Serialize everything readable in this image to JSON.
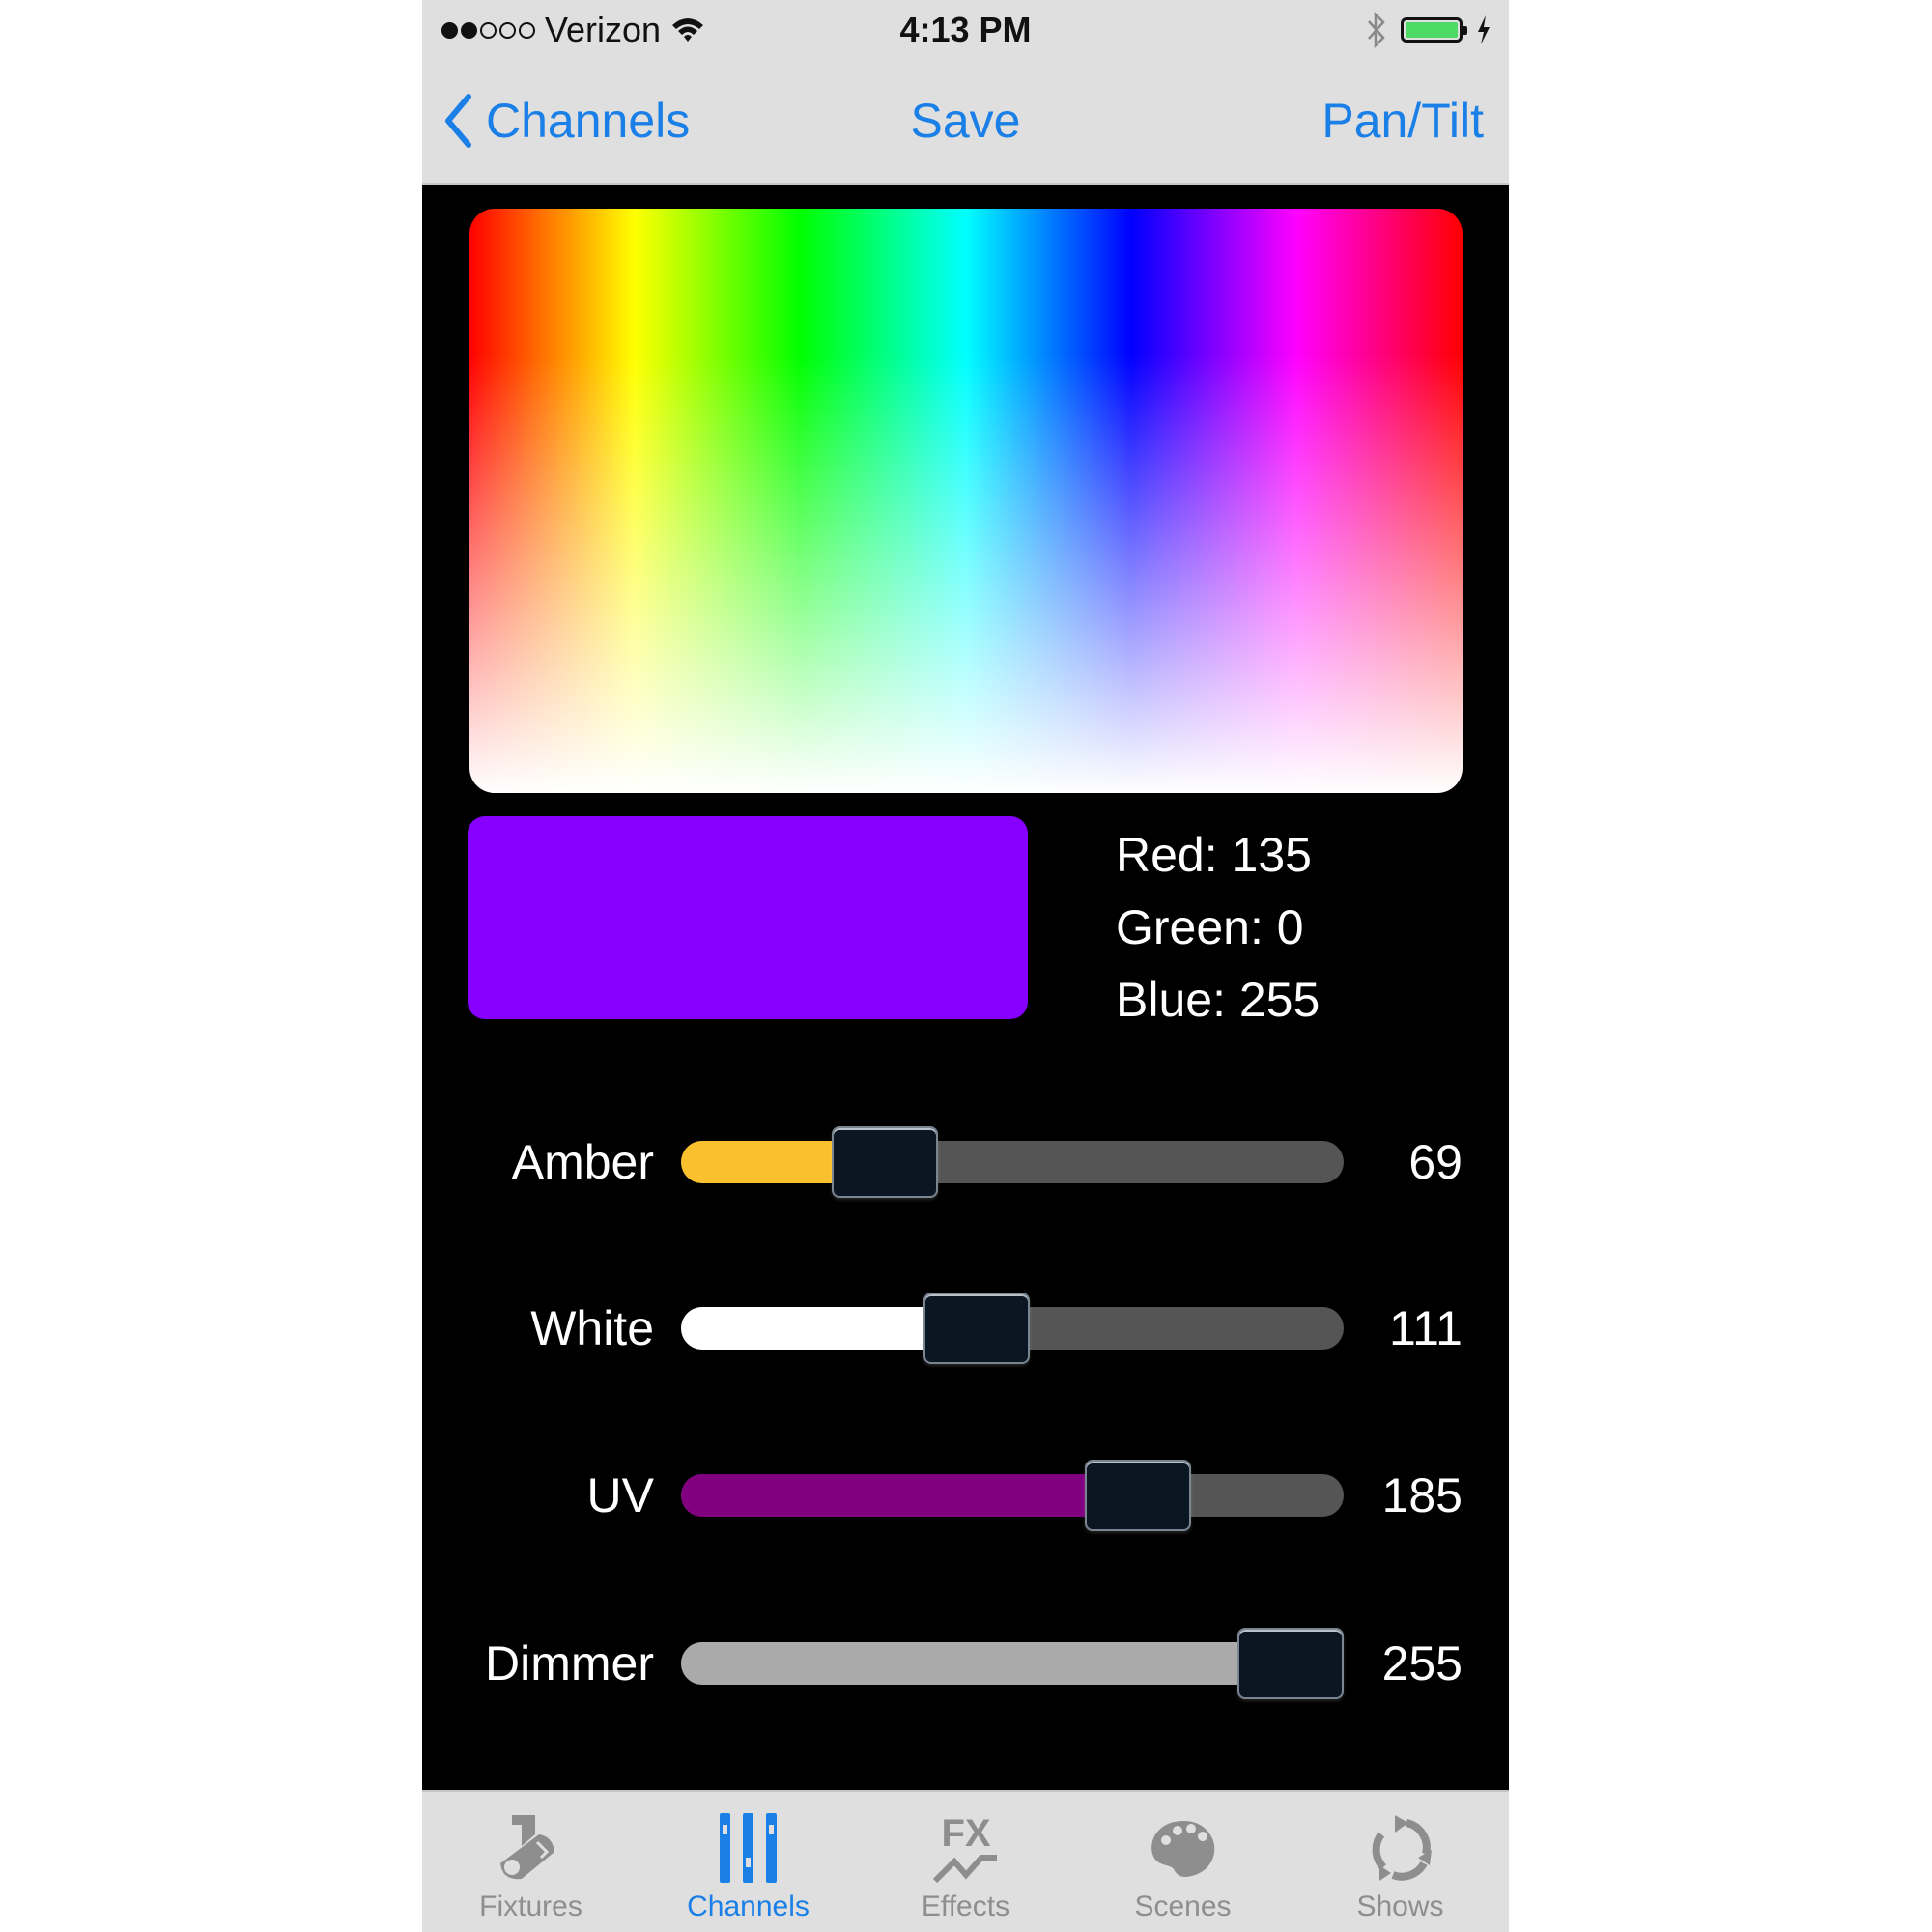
{
  "status_bar": {
    "signal_bars_filled": 2,
    "signal_bars_total": 5,
    "carrier": "Verizon",
    "time": "4:13 PM",
    "battery_charging": true
  },
  "nav": {
    "back_label": "Channels",
    "save_label": "Save",
    "right_label": "Pan/Tilt"
  },
  "color_picker": {
    "selected_color": "#8700FF",
    "rgb": {
      "red_text": "Red: 135",
      "green_text": "Green: 0",
      "blue_text": "Blue: 255"
    }
  },
  "sliders": [
    {
      "label": "Amber",
      "value": 69,
      "max": 255,
      "value_text": "69",
      "fill_color": "#FBC02D"
    },
    {
      "label": "White",
      "value": 111,
      "max": 255,
      "value_text": "111",
      "fill_color": "#FFFFFF"
    },
    {
      "label": "UV",
      "value": 185,
      "max": 255,
      "value_text": "185",
      "fill_color": "#800080"
    },
    {
      "label": "Dimmer",
      "value": 255,
      "max": 255,
      "value_text": "255",
      "fill_color": "#AAAAAA"
    }
  ],
  "tabs": [
    {
      "label": "Fixtures",
      "icon": "fixture-spotlight-icon",
      "active": false
    },
    {
      "label": "Channels",
      "icon": "sliders-icon",
      "active": true
    },
    {
      "label": "Effects",
      "icon": "fx-icon",
      "active": false
    },
    {
      "label": "Scenes",
      "icon": "palette-icon",
      "active": false
    },
    {
      "label": "Shows",
      "icon": "cycle-arrows-icon",
      "active": false
    }
  ],
  "colors": {
    "accent": "#1A7FE6",
    "bar_bg": "#DFDFDF",
    "inactive_tab": "#8E8E8E",
    "track_bg": "#555555"
  }
}
